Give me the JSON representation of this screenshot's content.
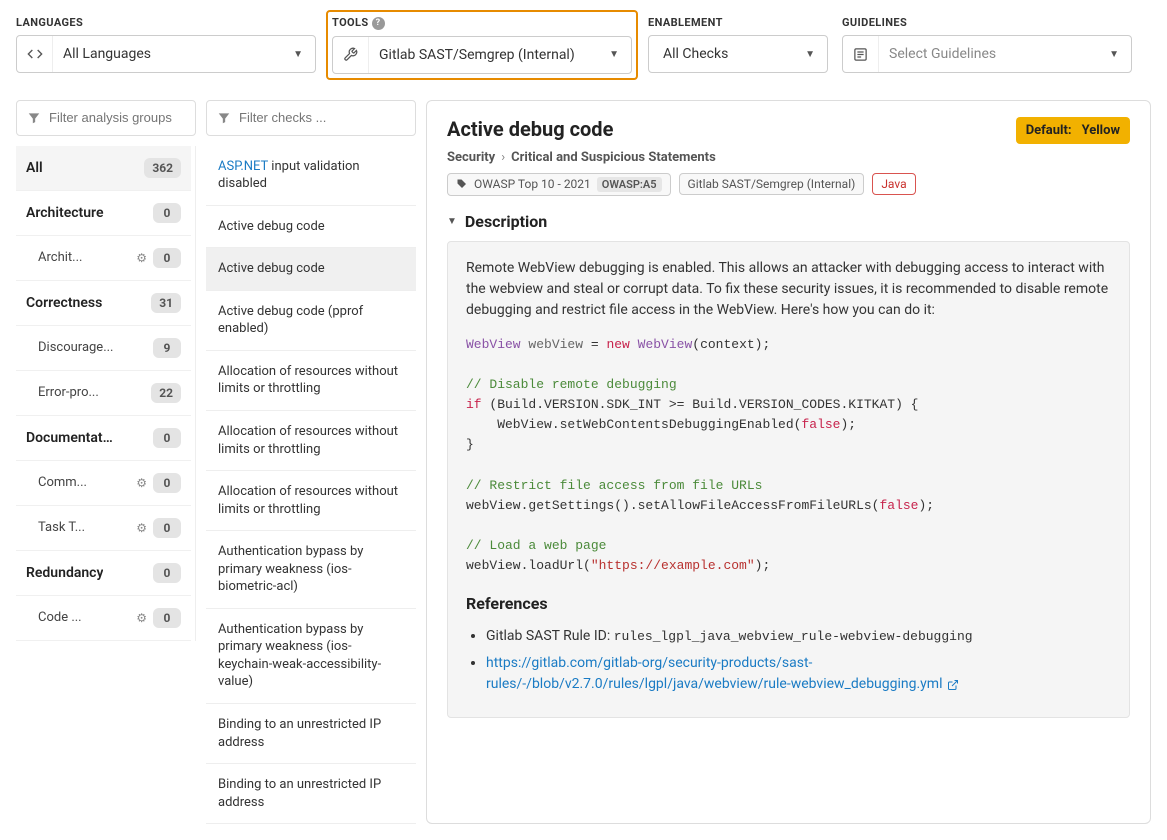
{
  "filters": {
    "languages": {
      "label": "LANGUAGES",
      "value": "All Languages"
    },
    "tools": {
      "label": "TOOLS",
      "value": "Gitlab SAST/Semgrep (Internal)"
    },
    "enablement": {
      "label": "ENABLEMENT",
      "value": "All Checks"
    },
    "guidelines": {
      "label": "GUIDELINES",
      "placeholder": "Select Guidelines"
    }
  },
  "search": {
    "groups_placeholder": "Filter analysis groups",
    "checks_placeholder": "Filter checks ..."
  },
  "groups": [
    {
      "label": "All",
      "count": "362",
      "active": true
    },
    {
      "label": "Architecture",
      "count": "0"
    },
    {
      "label": "Archit...",
      "count": "0",
      "sub": true,
      "gear": true
    },
    {
      "label": "Correctness",
      "count": "31"
    },
    {
      "label": "Discourage...",
      "count": "9",
      "sub": true
    },
    {
      "label": "Error-pro...",
      "count": "22",
      "sub": true
    },
    {
      "label": "Documentation",
      "count": "0"
    },
    {
      "label": "Comm...",
      "count": "0",
      "sub": true,
      "gear": true
    },
    {
      "label": "Task T...",
      "count": "0",
      "sub": true,
      "gear": true
    },
    {
      "label": "Redundancy",
      "count": "0"
    },
    {
      "label": "Code ...",
      "count": "0",
      "sub": true,
      "gear": true
    }
  ],
  "checks": [
    {
      "link": "ASP.NET",
      "rest": " input validation disabled"
    },
    {
      "text": "Active debug code"
    },
    {
      "text": "Active debug code",
      "selected": true
    },
    {
      "text": "Active debug code (pprof enabled)"
    },
    {
      "text": "Allocation of resources without limits or throttling"
    },
    {
      "text": "Allocation of resources without limits or throttling"
    },
    {
      "text": "Allocation of resources without limits or throttling"
    },
    {
      "text": "Authentication bypass by primary weakness (ios-biometric-acl)"
    },
    {
      "text": "Authentication bypass by primary weakness (ios-keychain-weak-accessibility-value)"
    },
    {
      "text": "Binding to an unrestricted IP address"
    },
    {
      "text": "Binding to an unrestricted IP address"
    }
  ],
  "detail": {
    "title": "Active debug code",
    "default_label": "Default:",
    "default_value": "Yellow",
    "breadcrumb": [
      "Security",
      "Critical and Suspicious Statements"
    ],
    "tags": {
      "owasp_text": "OWASP Top 10 - 2021",
      "owasp_badge": "OWASP:A5",
      "tool": "Gitlab SAST/Semgrep (Internal)",
      "lang": "Java"
    },
    "section_title": "Description",
    "description_text": "Remote WebView debugging is enabled. This allows an attacker with debugging access to interact with the webview and steal or corrupt data. To fix these security issues, it is recommended to disable remote debugging and restrict file access in the WebView. Here's how you can do it:",
    "code": {
      "l1_a": "WebView",
      "l1_b": "webView",
      "l1_c": "new",
      "l1_d": "WebView",
      "l1_e": "(context);",
      "c1": "// Disable remote debugging",
      "l2_if": "if",
      "l2_rest": " (Build.VERSION.SDK_INT >= Build.VERSION_CODES.KITKAT) {",
      "l3_a": "    WebView.setWebContentsDebuggingEnabled(",
      "l3_false": "false",
      "l3_b": ");",
      "l4": "}",
      "c2": "// Restrict file access from file URLs",
      "l5_a": "webView.getSettings().setAllowFileAccessFromFileURLs(",
      "l5_false": "false",
      "l5_b": ");",
      "c3": "// Load a web page",
      "l6_a": "webView.loadUrl(",
      "l6_str": "\"https://example.com\"",
      "l6_b": ");"
    },
    "references": {
      "title": "References",
      "rule_label": "Gitlab SAST Rule ID: ",
      "rule_id": "rules_lgpl_java_webview_rule-webview-debugging",
      "link": "https://gitlab.com/gitlab-org/security-products/sast-rules/-/blob/v2.7.0/rules/lgpl/java/webview/rule-webview_debugging.yml"
    }
  }
}
